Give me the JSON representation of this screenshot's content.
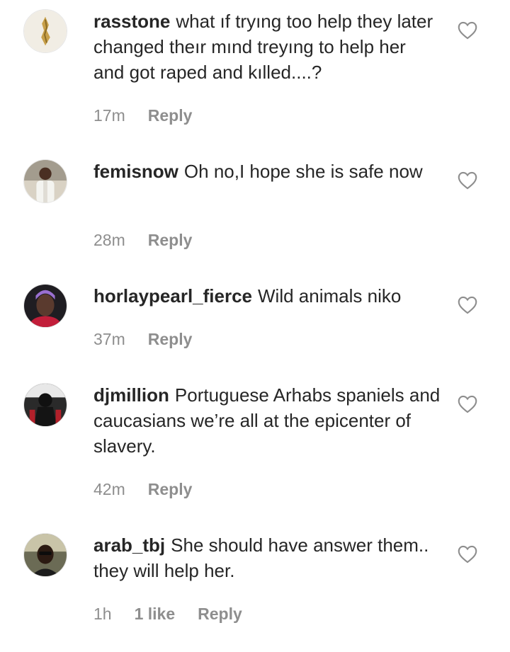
{
  "comments": [
    {
      "username": "rasstone",
      "text": "what ıf tryıng too help they later changed theır mınd treyıng to help her and got raped and kılled....?",
      "time": "17m",
      "likes": "",
      "reply_label": "Reply"
    },
    {
      "username": "femisnow",
      "text": "Oh no,I hope she is safe now",
      "time": "28m",
      "likes": "",
      "reply_label": "Reply"
    },
    {
      "username": "horlaypearl_fierce",
      "text": "Wild animals niko",
      "time": "37m",
      "likes": "",
      "reply_label": "Reply"
    },
    {
      "username": "djmillion",
      "text": "Portuguese Arhabs spaniels and caucasians we’re all at the epicenter of slavery.",
      "time": "42m",
      "likes": "",
      "reply_label": "Reply"
    },
    {
      "username": "arab_tbj",
      "text": "She should have answer them.. they will help her.",
      "time": "1h",
      "likes": "1 like",
      "reply_label": "Reply"
    }
  ],
  "colors": {
    "text": "#262626",
    "meta": "#8e8e8e",
    "background": "#ffffff"
  }
}
